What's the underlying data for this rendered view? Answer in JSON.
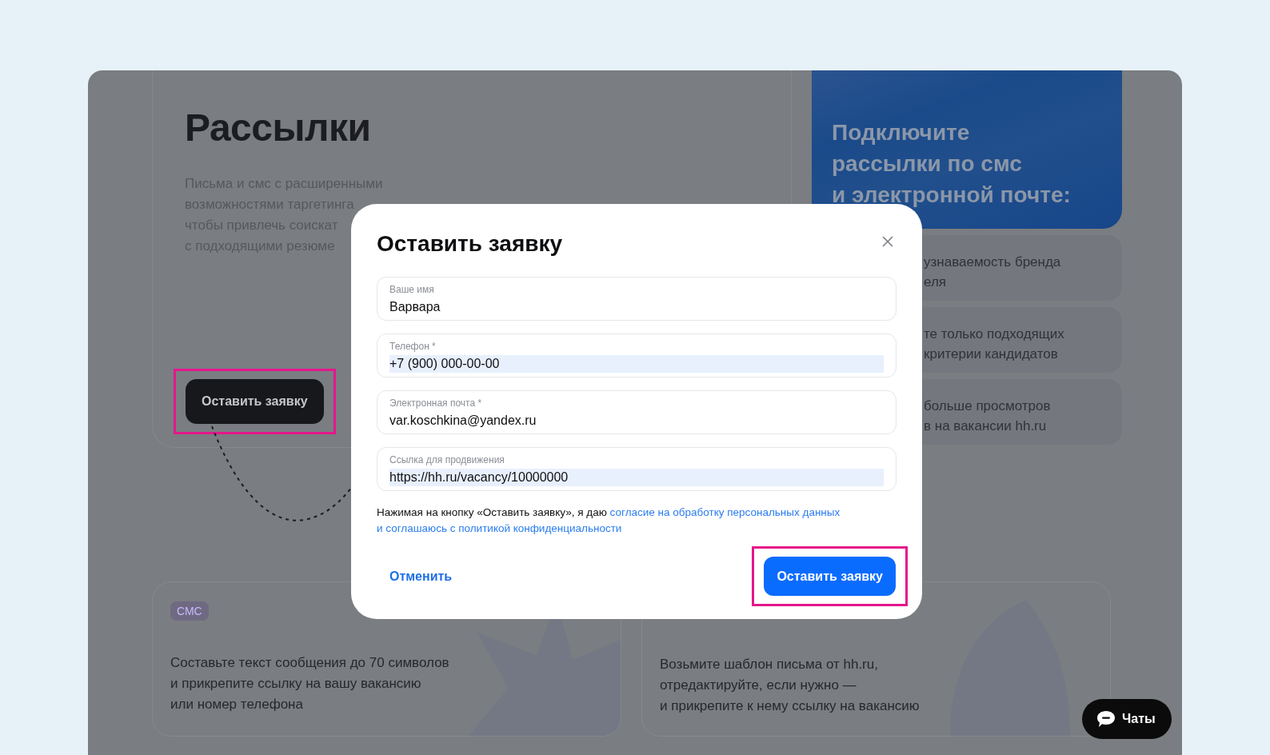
{
  "intro_card": {
    "title": "Рассылки",
    "description_lines": [
      "Письма и смс с расширенными",
      "возможностями таргетинга",
      "чтобы привлечь соискат",
      "с подходящими резюме"
    ],
    "button": {
      "label": "Оставить заявку",
      "highlighted": true
    }
  },
  "promo_card": {
    "title_lines": [
      "Подключите",
      "рассылки по смс",
      "и электронной почте:"
    ]
  },
  "benefits": [
    {
      "lines": [
        "узнаваемость бренда",
        "еля"
      ]
    },
    {
      "lines": [
        "те только подходящих",
        "критерии кандидатов"
      ]
    },
    {
      "lines": [
        "больше просмотров",
        "в на вакансии hh.ru"
      ]
    }
  ],
  "steps": [
    {
      "kind": "sms",
      "tag": "СМС",
      "lines": [
        "Составьте текст сообщения до 70 символов",
        "и прикрепите ссылку на вашу вакансию",
        "или номер телефона"
      ]
    },
    {
      "kind": "email",
      "lines": [
        "Возьмите шаблон письма от hh.ru,",
        "отредактируйте, если нужно —",
        "и прикрепите к нему ссылку на вакансию"
      ]
    }
  ],
  "modal": {
    "title": "Оставить заявку",
    "fields": [
      {
        "label": "Ваше имя",
        "value": "Варвара",
        "autofilled": false
      },
      {
        "label": "Телефон *",
        "value": "+7 (900) 000-00-00",
        "autofilled": true
      },
      {
        "label": "Электронная почта *",
        "value": "var.koschkina@yandex.ru",
        "autofilled": false
      },
      {
        "label": "Ссылка для продвижения",
        "value": "https://hh.ru/vacancy/10000000",
        "autofilled": true
      }
    ],
    "consent": {
      "text": "Нажимая на кнопку «Оставить заявку», я даю",
      "links": [
        "согласие на обработку персональных данных",
        "и соглашаюсь с политикой конфиденциальности"
      ]
    },
    "cancel": "Отменить",
    "submit": {
      "label": "Оставить заявку",
      "highlighted": true
    }
  },
  "chat_button": {
    "label": "Чаты"
  }
}
